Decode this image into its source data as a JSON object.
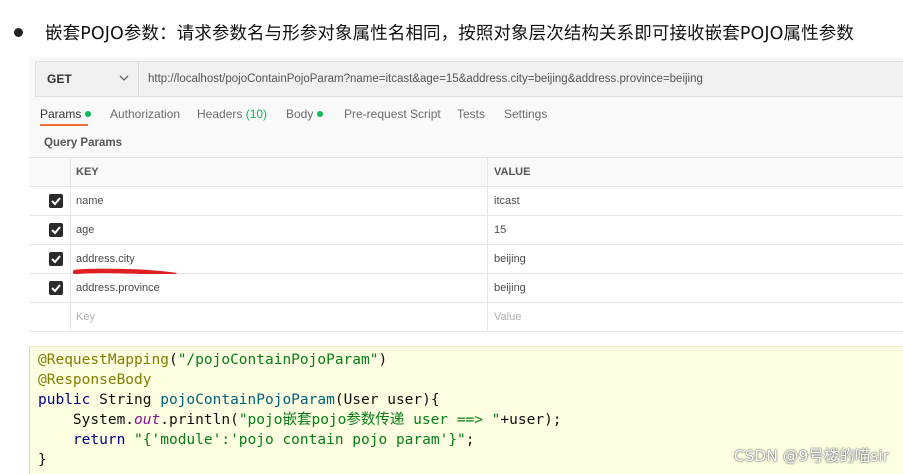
{
  "heading": "嵌套POJO参数：请求参数名与形参对象属性名相同，按照对象层次结构关系即可接收嵌套POJO属性参数",
  "request": {
    "method": "GET",
    "url": "http://localhost/pojoContainPojoParam?name=itcast&age=15&address.city=beijing&address.province=beijing"
  },
  "tabs": [
    {
      "label": "Params",
      "indicator": "dot",
      "active": true
    },
    {
      "label": "Authorization"
    },
    {
      "label": "Headers",
      "count": "(10)"
    },
    {
      "label": "Body",
      "indicator": "dot"
    },
    {
      "label": "Pre-request Script"
    },
    {
      "label": "Tests"
    },
    {
      "label": "Settings"
    }
  ],
  "query_params": {
    "title": "Query Params",
    "columns": {
      "key": "KEY",
      "value": "VALUE"
    },
    "rows": [
      {
        "key": "name",
        "value": "itcast",
        "checked": true
      },
      {
        "key": "age",
        "value": "15",
        "checked": true
      },
      {
        "key": "address.city",
        "value": "beijing",
        "checked": true,
        "highlighted": true
      },
      {
        "key": "address.province",
        "value": "beijing",
        "checked": true
      }
    ],
    "placeholder": {
      "key": "Key",
      "value": "Value"
    }
  },
  "code": {
    "line1": {
      "annotation": "@RequestMapping",
      "open": "(",
      "string": "\"/pojoContainPojoParam\"",
      "close": ")"
    },
    "line2": {
      "annotation": "@ResponseBody"
    },
    "line3": {
      "kw_public": "public",
      "type": " String ",
      "method": "pojoContainPojoParam",
      "params": "(User user){"
    },
    "line4": {
      "indent": "    ",
      "recv": "System.",
      "field": "out",
      "call": ".println(",
      "string": "\"pojo嵌套pojo参数传递 user ==> \"",
      "rest": "+user);"
    },
    "line5": {
      "indent": "    ",
      "kw_return": "return",
      "space": " ",
      "string": "\"{'module':'pojo contain pojo param'}\"",
      "end": ";"
    },
    "line6": {
      "brace": "}"
    }
  },
  "watermark": "CSDN @9号楼的喵sir",
  "colors": {
    "accent_tab": "#f26b3a",
    "indicator_green": "#0cbb52",
    "highlight_red": "#e02020",
    "code_bg": "#fdfde1"
  }
}
